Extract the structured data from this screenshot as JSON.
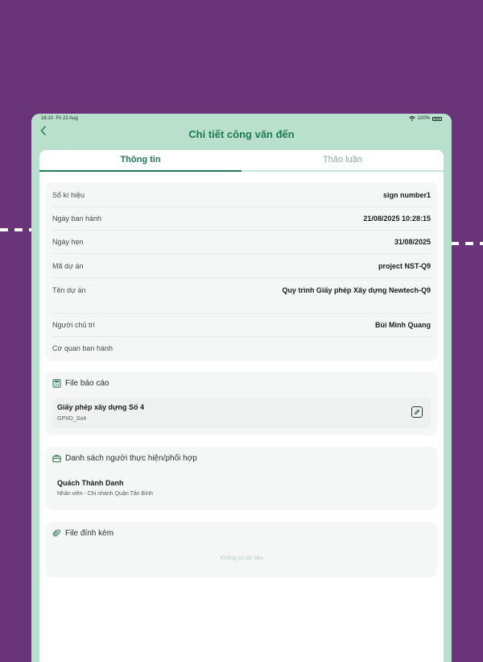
{
  "status_bar": {
    "time": "16:10",
    "date": "Fri 22 Aug",
    "wifi_icon": "wifi-icon",
    "battery": "100%"
  },
  "header": {
    "back_icon": "chevron-left-icon",
    "title": "Chi tiết công văn đến"
  },
  "tabs": [
    {
      "label": "Thông tin",
      "active": true
    },
    {
      "label": "Thảo luận",
      "active": false
    }
  ],
  "info": {
    "rows": [
      {
        "label": "Số kí hiệu",
        "value": "sign number1"
      },
      {
        "label": "Ngày ban hành",
        "value": "21/08/2025 10:28:15"
      },
      {
        "label": "Ngày hẹn",
        "value": "31/08/2025"
      },
      {
        "label": "Mã dự án",
        "value": "project NST-Q9"
      },
      {
        "label": "Tên dự án",
        "value": "Quy trình Giấy phép Xây dựng Newtech-Q9"
      },
      {
        "label": "Người chủ trì",
        "value": "Bùi Minh Quang"
      },
      {
        "label": "Cơ quan ban hành",
        "value": ""
      }
    ]
  },
  "report_section": {
    "icon": "calculator-icon",
    "title": "File báo cáo",
    "file": {
      "name": "Giấy phép xây dựng Số 4",
      "code": "GPXD_So4",
      "edit_icon": "edit-icon"
    }
  },
  "people_section": {
    "icon": "briefcase-icon",
    "title": "Danh sách người thực hiện/phối hợp",
    "people": [
      {
        "name": "Quách Thành Danh",
        "role": "Nhân viên - Chi nhánh Quận Tân Bình"
      }
    ]
  },
  "attachments_section": {
    "icon": "paperclip-icon",
    "title": "File đính kèm",
    "empty_text": "Không có dữ liệu"
  },
  "colors": {
    "background": "#6a3478",
    "header": "#b8e0cc",
    "accent": "#1e7a52"
  }
}
